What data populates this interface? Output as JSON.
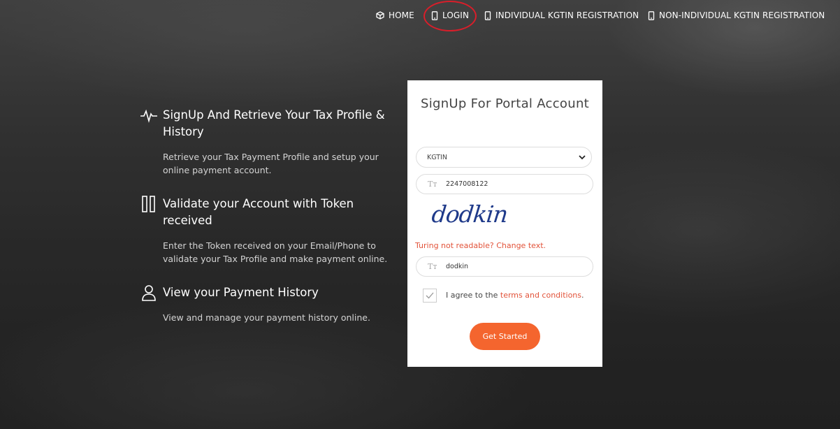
{
  "nav": {
    "home": "HOME",
    "login": "LOGIN",
    "individual": "INDIVIDUAL KGTIN REGISTRATION",
    "non_individual": "NON-INDIVIDUAL KGTIN REGISTRATION"
  },
  "features": [
    {
      "icon": "pulse-icon",
      "title": "SignUp And Retrieve Your Tax Profile & History",
      "desc": "Retrieve your Tax Payment Profile and setup your online payment account."
    },
    {
      "icon": "columns-icon",
      "title": "Validate your Account with Token received",
      "desc": "Enter the Token received on your Email/Phone to validate your Tax Profile and make payment online."
    },
    {
      "icon": "user-icon",
      "title": "View your Payment History",
      "desc": "View and manage your payment history online."
    }
  ],
  "form": {
    "title": "SignUp For Portal Account",
    "id_type": "KGTIN",
    "id_value": "2247008122",
    "captcha_text": "dodkin",
    "captcha_link": "Turing not readable? Change text.",
    "captcha_input": "dodkin",
    "agree_prefix": "I agree to the",
    "terms_link": "terms and conditions",
    "agree_suffix": ".",
    "submit": "Get Started"
  },
  "colors": {
    "accent": "#f4652e",
    "link": "#e2533a",
    "annotation_circle": "#d91e2a",
    "captcha": "#1f3a8a"
  }
}
